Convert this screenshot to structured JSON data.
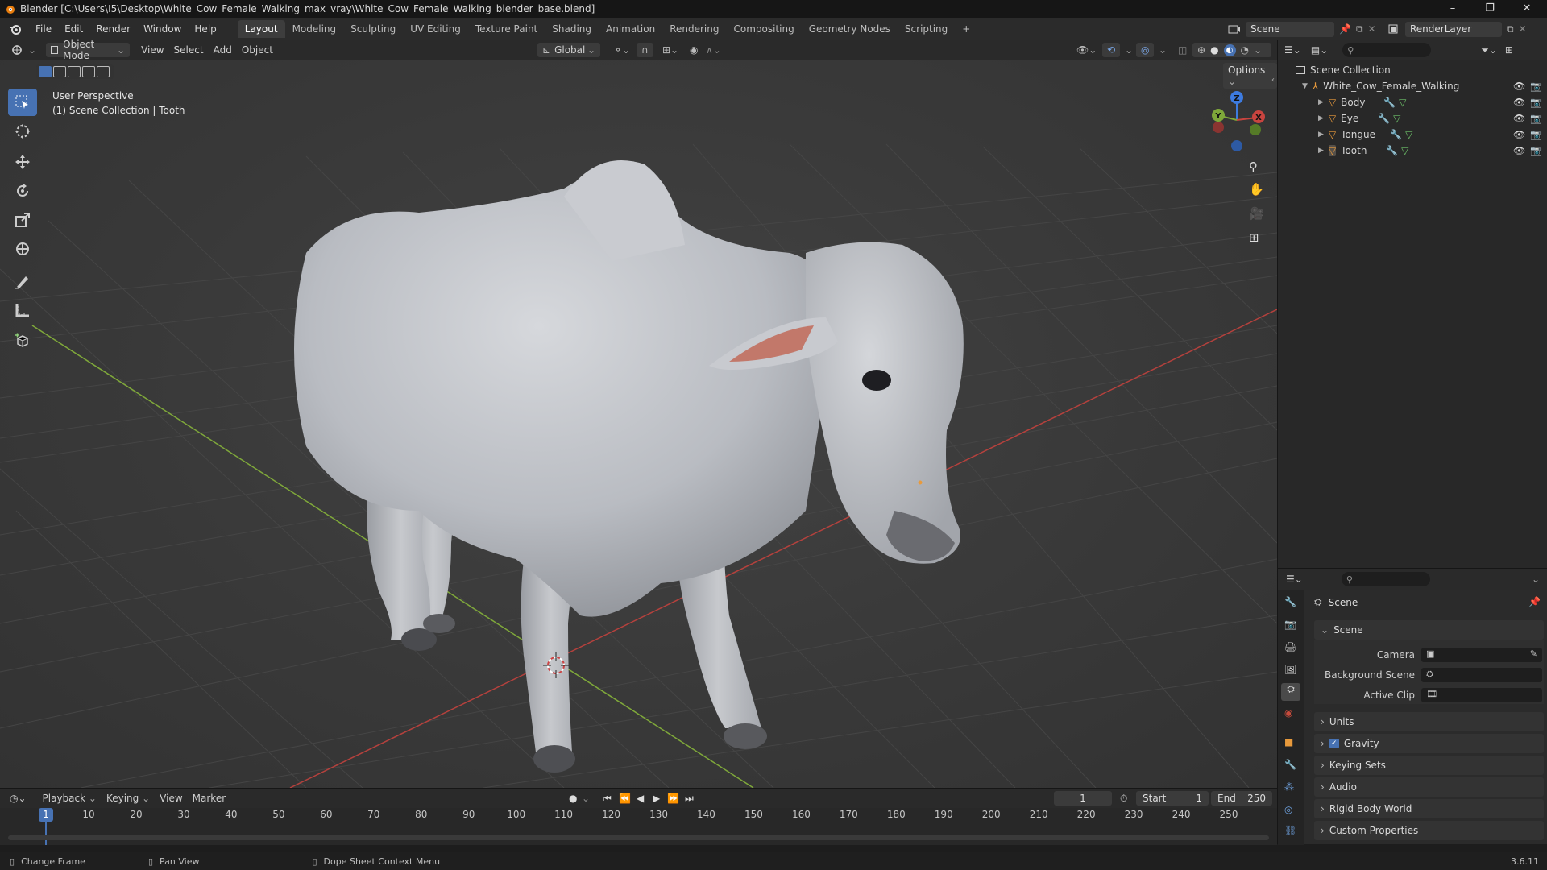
{
  "window": {
    "title": "Blender [C:\\Users\\I5\\Desktop\\White_Cow_Female_Walking_max_vray\\White_Cow_Female_Walking_blender_base.blend]",
    "minimize": "–",
    "maximize": "❐",
    "close": "✕"
  },
  "menu": [
    "File",
    "Edit",
    "Render",
    "Window",
    "Help"
  ],
  "workspaces": [
    "Layout",
    "Modeling",
    "Sculpting",
    "UV Editing",
    "Texture Paint",
    "Shading",
    "Animation",
    "Rendering",
    "Compositing",
    "Geometry Nodes",
    "Scripting"
  ],
  "workspace_add": "+",
  "scene_selector": {
    "value": "Scene"
  },
  "view_layer": {
    "value": "RenderLayer"
  },
  "viewport_header": {
    "mode": "Object Mode",
    "menus": [
      "View",
      "Select",
      "Add",
      "Object"
    ],
    "transform_orientation": "Global",
    "options": "Options"
  },
  "viewport": {
    "overlay_line1": "User Perspective",
    "overlay_line2": "(1) Scene Collection | Tooth",
    "gizmo": {
      "z": "Z",
      "y": "Y",
      "x": "X"
    }
  },
  "outliner": {
    "root": "Scene Collection",
    "collection": "White_Cow_Female_Walking",
    "objects": [
      "Body",
      "Eye",
      "Tongue",
      "Tooth"
    ]
  },
  "properties": {
    "context": "Scene",
    "panel_scene": "Scene",
    "fields": {
      "camera_label": "Camera",
      "background_label": "Background Scene",
      "clip_label": "Active Clip"
    },
    "collapsed_panels": [
      "Units",
      "Gravity",
      "Keying Sets",
      "Audio",
      "Rigid Body World",
      "Custom Properties"
    ],
    "gravity_checked": true
  },
  "timeline": {
    "menus": [
      "Playback",
      "Keying",
      "View",
      "Marker"
    ],
    "current_frame": "1",
    "start_label": "Start",
    "start_value": "1",
    "end_label": "End",
    "end_value": "250",
    "ticks": [
      "1",
      "10",
      "20",
      "30",
      "40",
      "50",
      "60",
      "70",
      "80",
      "90",
      "100",
      "110",
      "120",
      "130",
      "140",
      "150",
      "160",
      "170",
      "180",
      "190",
      "200",
      "210",
      "220",
      "230",
      "240",
      "250"
    ]
  },
  "statusbar": {
    "left": "Change Frame",
    "middle": "Pan View",
    "right": "Dope Sheet Context Menu",
    "version": "3.6.11"
  },
  "colors": {
    "accent": "#4772b3",
    "x_axis": "#c8443f",
    "y_axis": "#7fa83a",
    "z_axis": "#3d7be0",
    "object_orange": "#e89a3c"
  }
}
